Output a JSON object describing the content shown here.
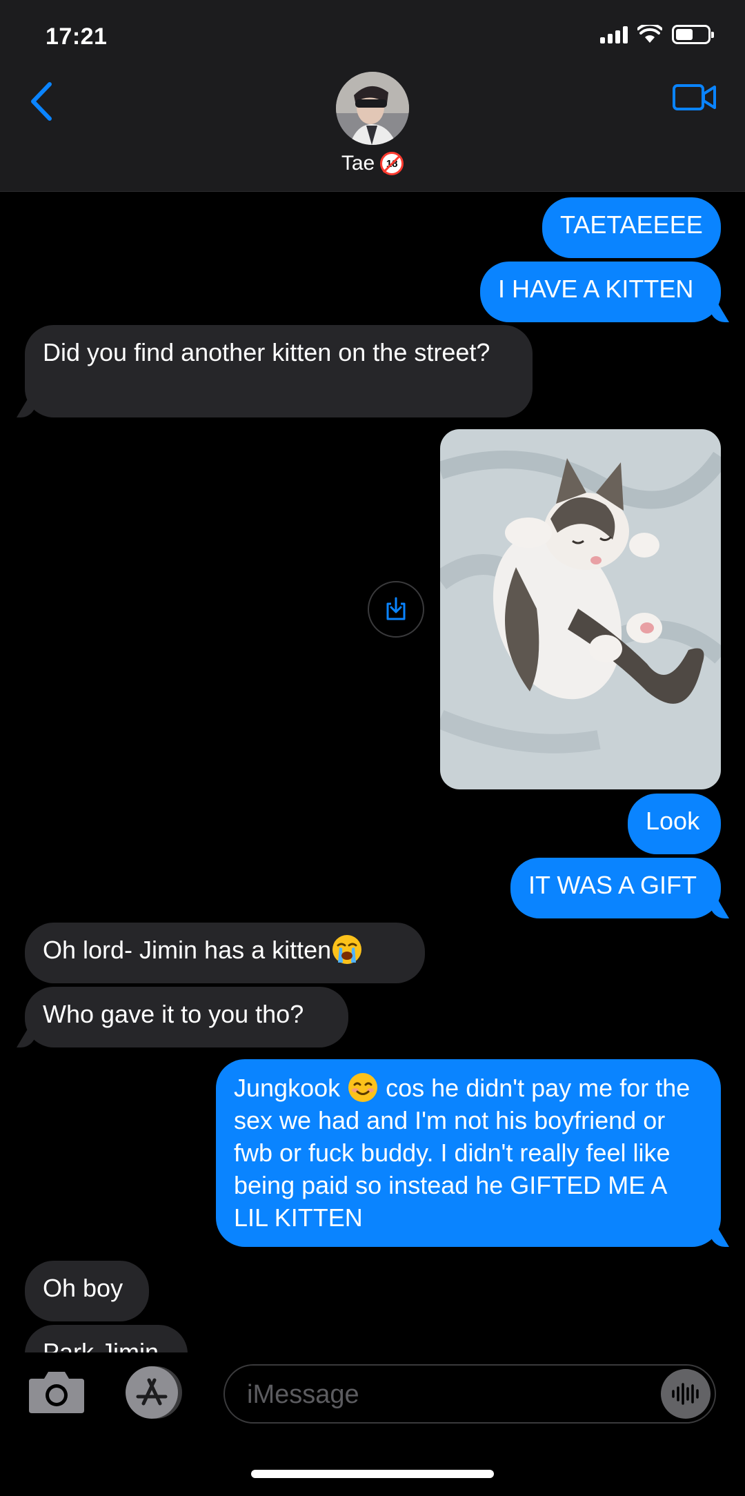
{
  "status_bar": {
    "time": "17:21",
    "battery_level": 0.55
  },
  "header": {
    "contact_name": "Tae",
    "badge_text": "18",
    "icons": {
      "back": "chevron-left-icon",
      "video": "video-camera-icon"
    }
  },
  "messages": [
    {
      "from": "me",
      "text": "TAETAEEEE"
    },
    {
      "from": "me",
      "text": "I HAVE A KITTEN"
    },
    {
      "from": "them",
      "text": "Did you find another kitten on the street?"
    },
    {
      "from": "me",
      "type": "photo",
      "description_icon": "kitten-photo"
    },
    {
      "from": "me",
      "text": "Look"
    },
    {
      "from": "me",
      "text": "IT WAS A GIFT"
    },
    {
      "from": "them",
      "text": "Oh lord- Jimin has a kitten",
      "emoji": "loudly-crying-face"
    },
    {
      "from": "them",
      "text": "Who gave it to you tho?"
    },
    {
      "from": "me",
      "text_before_emoji": "Jungkook",
      "emoji": "smiling-face",
      "text_after_emoji": " cos he didn't pay me for the sex we had and I'm not his boyfriend or fwb or fuck buddy. I didn't really feel like being paid so instead he GIFTED ME A LIL KITTEN"
    },
    {
      "from": "them",
      "text": "Oh boy"
    },
    {
      "from": "them",
      "text": "Park Jimin"
    }
  ],
  "composer": {
    "placeholder": "iMessage",
    "icons": {
      "camera": "camera-icon",
      "apps": "app-store-icon",
      "audio": "audio-waveform-icon"
    }
  },
  "colors": {
    "outgoing": "#0a84ff",
    "incoming": "#262629",
    "accent": "#0a84ff",
    "background": "#000000"
  }
}
